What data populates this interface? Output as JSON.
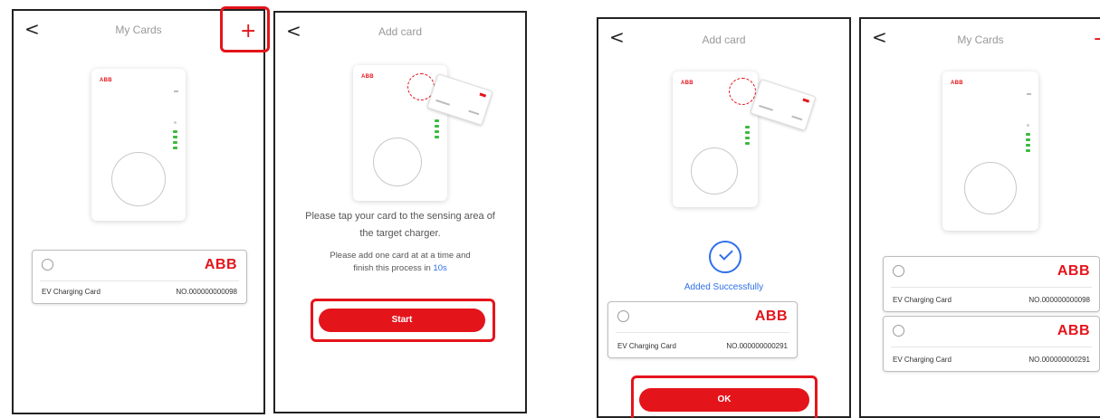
{
  "screens": [
    {
      "title": "My Cards",
      "back_glyph": "<",
      "add_glyph": "+",
      "cards": [
        {
          "brand": "ABB",
          "name": "EV Charging Card",
          "number": "NO.000000000098"
        }
      ]
    },
    {
      "title": "Add card",
      "back_glyph": "<",
      "instruction_line1": "Please tap your card to the sensing area of",
      "instruction_line2": "the target charger.",
      "note_line1": "Please add one card at at a time and",
      "note_line2_prefix": "finish this process in ",
      "note_line2_time": "10s",
      "start_label": "Start"
    },
    {
      "title": "Add card",
      "back_glyph": "<",
      "success_text": "Added Successfully",
      "cards": [
        {
          "brand": "ABB",
          "name": "EV Charging Card",
          "number": "NO.000000000291"
        }
      ],
      "ok_label": "OK"
    },
    {
      "title": "My Cards",
      "back_glyph": "<",
      "add_glyph": "+",
      "cards": [
        {
          "brand": "ABB",
          "name": "EV Charging Card",
          "number": "NO.000000000098"
        },
        {
          "brand": "ABB",
          "name": "EV Charging Card",
          "number": "NO.000000000291"
        }
      ]
    }
  ],
  "device_logo": "ABB",
  "icons": {
    "back": "chevron-left-icon",
    "add": "plus-icon",
    "radio": "radio-unselected-icon",
    "success": "check-circle-icon"
  },
  "colors": {
    "accent_red": "#e4141b",
    "link_blue": "#2f6fea",
    "led_green": "#3cba3c"
  }
}
